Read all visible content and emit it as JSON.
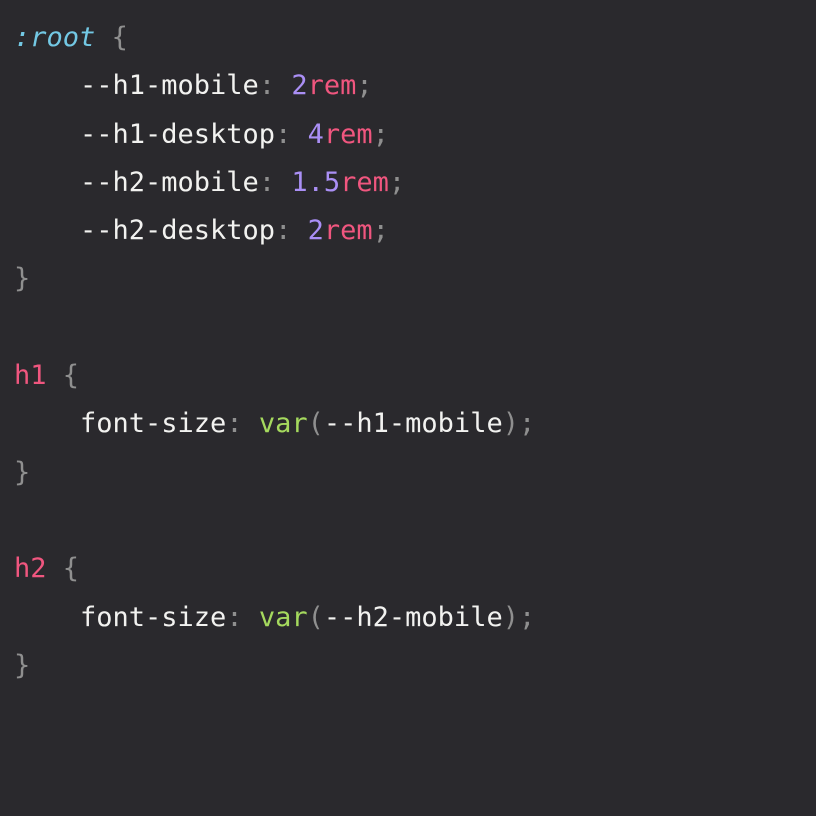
{
  "colors": {
    "background": "#2a292d",
    "pseudo_selector": "#73c8e4",
    "punctuation": "#8f8f8f",
    "property": "#f2f2f0",
    "number": "#aa8ff5",
    "unit_and_tag": "#f0567f",
    "function": "#a5d95e"
  },
  "code": {
    "root_rule": {
      "selector_colon": ":",
      "selector_name": "root",
      "open_brace": "{",
      "close_brace": "}",
      "declarations": [
        {
          "property": "--h1-mobile",
          "number": "2",
          "unit": "rem"
        },
        {
          "property": "--h1-desktop",
          "number": "4",
          "unit": "rem"
        },
        {
          "property": "--h2-mobile",
          "number": "1.5",
          "unit": "rem"
        },
        {
          "property": "--h2-desktop",
          "number": "2",
          "unit": "rem"
        }
      ]
    },
    "h1_rule": {
      "selector": "h1",
      "open_brace": "{",
      "close_brace": "}",
      "property": "font-size",
      "function": "var",
      "argument": "--h1-mobile"
    },
    "h2_rule": {
      "selector": "h2",
      "open_brace": "{",
      "close_brace": "}",
      "property": "font-size",
      "function": "var",
      "argument": "--h2-mobile"
    },
    "colon": ":",
    "semicolon": ";",
    "open_paren": "(",
    "close_paren": ")"
  }
}
